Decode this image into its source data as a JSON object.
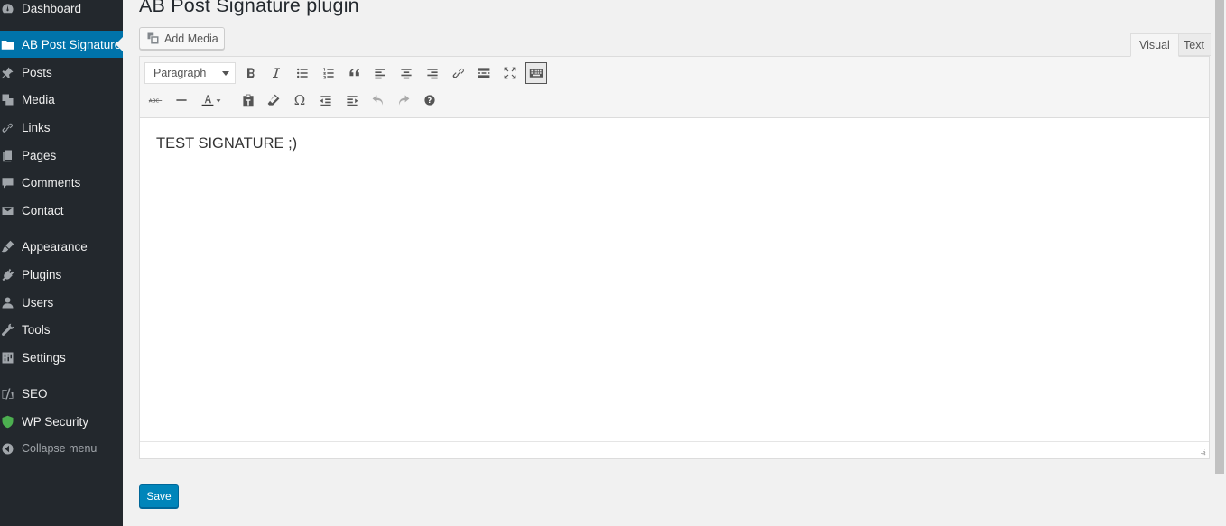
{
  "sidebar": {
    "items": [
      {
        "label": "Dashboard",
        "icon": "dashboard-icon"
      },
      {
        "label": "AB Post Signature",
        "icon": "folder-icon",
        "active": true
      },
      {
        "label": "Posts",
        "icon": "pin-icon"
      },
      {
        "label": "Media",
        "icon": "media-icon"
      },
      {
        "label": "Links",
        "icon": "link-icon"
      },
      {
        "label": "Pages",
        "icon": "pages-icon"
      },
      {
        "label": "Comments",
        "icon": "comment-icon"
      },
      {
        "label": "Contact",
        "icon": "mail-icon"
      },
      {
        "label": "Appearance",
        "icon": "brush-icon"
      },
      {
        "label": "Plugins",
        "icon": "plugin-icon"
      },
      {
        "label": "Users",
        "icon": "user-icon"
      },
      {
        "label": "Tools",
        "icon": "wrench-icon"
      },
      {
        "label": "Settings",
        "icon": "settings-icon"
      },
      {
        "label": "SEO",
        "icon": "yoast-icon"
      },
      {
        "label": "WP Security",
        "icon": "shield-icon"
      }
    ],
    "collapse_label": "Collapse menu"
  },
  "page": {
    "title": "AB Post Signature plugin"
  },
  "editor": {
    "add_media_label": "Add Media",
    "tabs": {
      "visual": "Visual",
      "text": "Text"
    },
    "format_select": "Paragraph",
    "content": "TEST SIGNATURE ;)"
  },
  "toolbar_row1": [
    "bold",
    "italic",
    "bullet-list",
    "numbered-list",
    "blockquote",
    "align-left",
    "align-center",
    "align-right",
    "link",
    "read-more",
    "fullscreen",
    "toolbar-toggle"
  ],
  "toolbar_row2": [
    "strikethrough",
    "horizontal-line",
    "text-color",
    "paste-as-text",
    "clear-formatting",
    "special-character",
    "outdent",
    "indent",
    "undo",
    "redo",
    "help"
  ],
  "save_label": "Save",
  "colors": {
    "sidebar_bg": "#23282d",
    "active": "#0073aa",
    "primary_button": "#0085ba"
  }
}
